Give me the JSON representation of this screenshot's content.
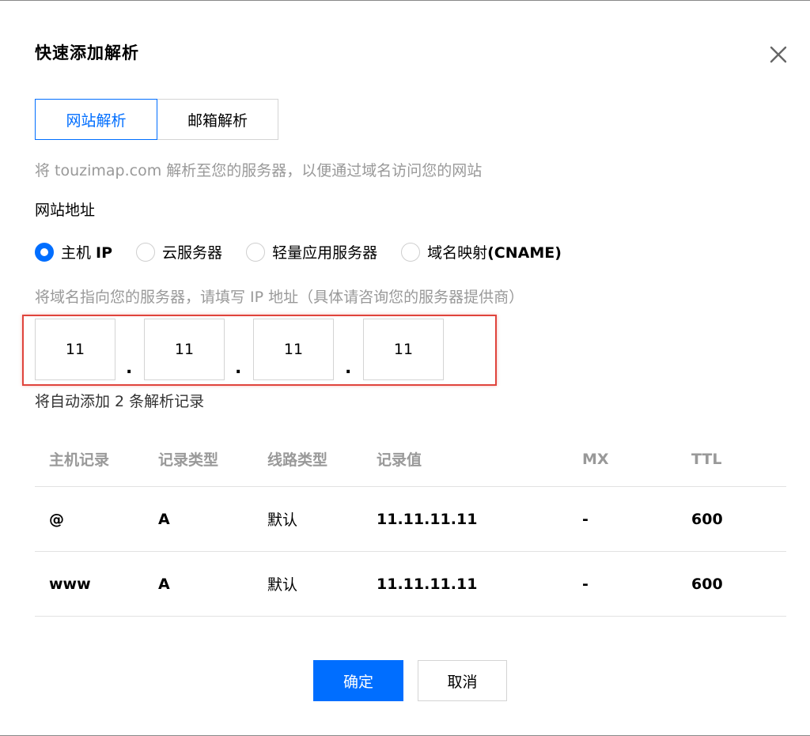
{
  "dialog": {
    "title": "快速添加解析"
  },
  "tabs": [
    {
      "label": "网站解析",
      "active": true
    },
    {
      "label": "邮箱解析",
      "active": false
    }
  ],
  "description": "将 touzimap.com 解析至您的服务器，以便通过域名访问您的网站",
  "website_address": {
    "label": "网站地址",
    "options": [
      {
        "label_prefix": "主机 ",
        "label_bold": "IP",
        "checked": true
      },
      {
        "label_prefix": "云服务器",
        "label_bold": "",
        "checked": false
      },
      {
        "label_prefix": "轻量应用服务器",
        "label_bold": "",
        "checked": false
      },
      {
        "label_prefix": "域名映射",
        "label_bold": "(CNAME)",
        "checked": false
      }
    ]
  },
  "ip_hint": "将域名指向您的服务器，请填写 IP 地址（具体请咨询您的服务器提供商）",
  "ip_octets": [
    "11",
    "11",
    "11",
    "11"
  ],
  "ip_separator": ".",
  "records_note": "将自动添加 2 条解析记录",
  "table": {
    "headers": [
      "主机记录",
      "记录类型",
      "线路类型",
      "记录值",
      "MX",
      "TTL"
    ],
    "rows": [
      [
        "@",
        "A",
        "默认",
        "11.11.11.11",
        "-",
        "600"
      ],
      [
        "www",
        "A",
        "默认",
        "11.11.11.11",
        "-",
        "600"
      ]
    ]
  },
  "buttons": {
    "confirm": "确定",
    "cancel": "取消"
  },
  "colors": {
    "accent": "#006eff",
    "highlight": "#e0443c",
    "muted_text": "#999999"
  },
  "icons": {
    "close": "close-icon"
  }
}
